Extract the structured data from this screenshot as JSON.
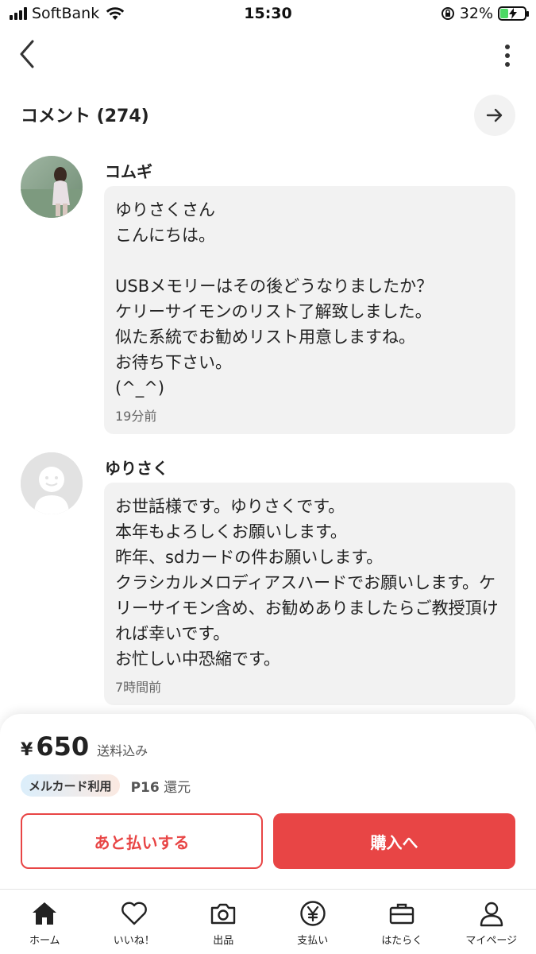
{
  "status_bar": {
    "carrier": "SoftBank",
    "time": "15:30",
    "battery_percent": "32%",
    "battery_level": 0.32
  },
  "comments_header": {
    "title": "コメント (274)"
  },
  "comments": [
    {
      "author": "コムギ",
      "text": "ゆりさくさん\nこんにちは。\n\nUSBメモリーはその後どうなりましたか？\nケリーサイモンのリスト了解致しました。\n似た系統でお勧めリスト用意しますね。\nお待ち下さい。\n(^_^)",
      "time": "19分前"
    },
    {
      "author": "ゆりさく",
      "text": "お世話様です。ゆりさくです。\n本年もよろしくお願いします。\n昨年、sdカードの件お願いします。\nクラシカルメロディアスハードでお願いします。ケリーサイモン含め、お勧めありましたらご教授頂ければ幸いです。\nお忙しい中恐縮です。",
      "time": "7時間前"
    }
  ],
  "purchase": {
    "currency": "¥",
    "price": "650",
    "shipping_note": "送料込み",
    "badge": "メルカード利用",
    "points_value": "P16",
    "points_suffix": "還元",
    "later_button": "あと払いする",
    "buy_button": "購入へ",
    "accent_color": "#e84545"
  },
  "tab_bar": {
    "tabs": [
      {
        "label": "ホーム",
        "icon": "home-icon"
      },
      {
        "label": "いいね！",
        "icon": "heart-icon"
      },
      {
        "label": "出品",
        "icon": "camera-icon"
      },
      {
        "label": "支払い",
        "icon": "yen-icon"
      },
      {
        "label": "はたらく",
        "icon": "briefcase-icon"
      },
      {
        "label": "マイページ",
        "icon": "person-icon"
      }
    ]
  }
}
